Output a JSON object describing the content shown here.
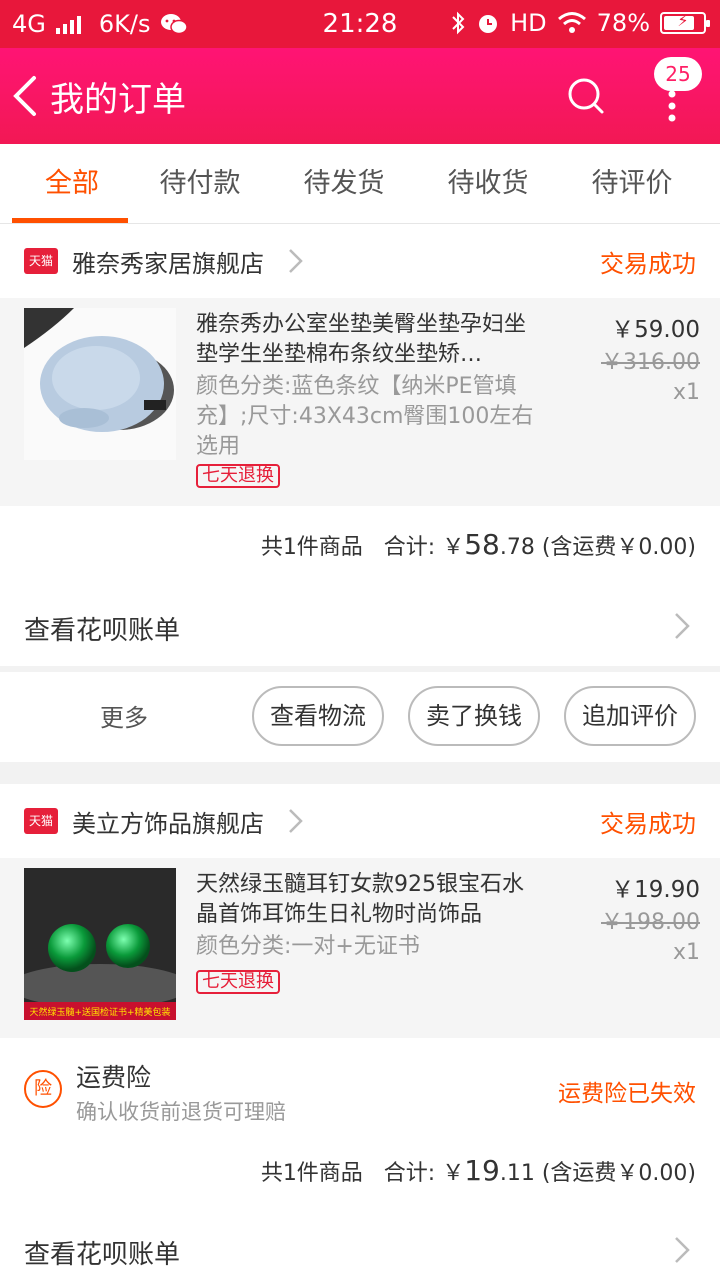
{
  "status_bar": {
    "network": "4G",
    "speed": "6K/s",
    "time": "21:28",
    "hd": "HD",
    "battery": "78%",
    "battery_level": 0.78,
    "icons": [
      "signal-icon",
      "wechat-icon",
      "bluetooth-icon",
      "alarm-icon",
      "wifi-icon",
      "battery-icon"
    ]
  },
  "header": {
    "title": "我的订单",
    "badge_count": "25",
    "bg_color": "#ff1474"
  },
  "tabs": [
    {
      "label": "全部",
      "active": true
    },
    {
      "label": "待付款",
      "active": false
    },
    {
      "label": "待发货",
      "active": false
    },
    {
      "label": "待收货",
      "active": false
    },
    {
      "label": "待评价",
      "active": false
    }
  ],
  "accent_color": "#ff5000",
  "orders": [
    {
      "shop_badge": "天猫",
      "shop_name": "雅奈秀家居旗舰店",
      "status": "交易成功",
      "item": {
        "title": "雅奈秀办公室坐垫美臀坐垫孕妇坐垫学生坐垫棉布条纹坐垫矫…",
        "sku": "颜色分类:蓝色条纹【纳米PE管填充】;尺寸:43X43cm臀围100左右选用",
        "tag": "七天退换",
        "price": "￥59.00",
        "original_price": "￥316.00",
        "qty": "x1"
      },
      "summary": {
        "count": "共1件商品",
        "total_label": "合计: ￥",
        "total_int": "58",
        "total_dec": ".78",
        "shipping": "(含运费￥0.00)"
      },
      "huabei_label": "查看花呗账单",
      "more_label": "更多",
      "buttons": [
        "查看物流",
        "卖了换钱",
        "追加评价"
      ]
    },
    {
      "shop_badge": "天猫",
      "shop_name": "美立方饰品旗舰店",
      "status": "交易成功",
      "item": {
        "title": "天然绿玉髓耳钉女款925银宝石水晶首饰耳饰生日礼物时尚饰品",
        "sku": "颜色分类:一对+无证书",
        "tag": "七天退换",
        "price": "￥19.90",
        "original_price": "￥198.00",
        "qty": "x1",
        "banner_text": "天然绿玉髓+送国检证书+精美包装"
      },
      "insurance": {
        "icon_text": "险",
        "title": "运费险",
        "desc": "确认收货前退货可理赔",
        "status": "运费险已失效"
      },
      "summary": {
        "count": "共1件商品",
        "total_label": "合计: ￥",
        "total_int": "19",
        "total_dec": ".11",
        "shipping": "(含运费￥0.00)"
      },
      "huabei_label": "查看花呗账单"
    }
  ]
}
